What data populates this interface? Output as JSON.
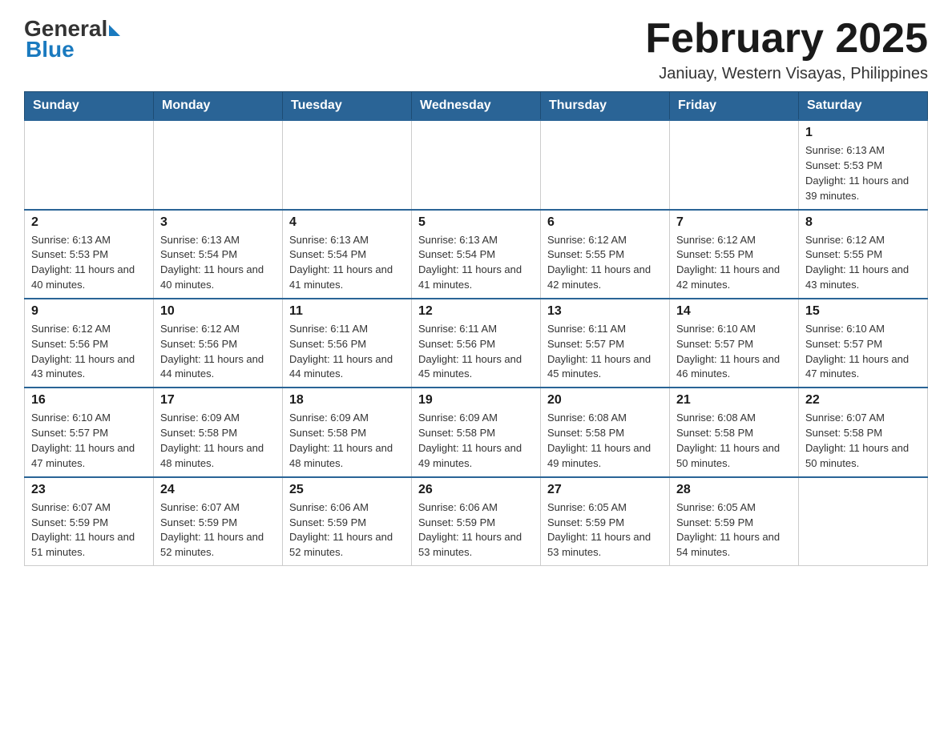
{
  "logo": {
    "general": "General",
    "blue": "Blue"
  },
  "title": "February 2025",
  "subtitle": "Janiuay, Western Visayas, Philippines",
  "days_of_week": [
    "Sunday",
    "Monday",
    "Tuesday",
    "Wednesday",
    "Thursday",
    "Friday",
    "Saturday"
  ],
  "weeks": [
    [
      {
        "day": "",
        "info": ""
      },
      {
        "day": "",
        "info": ""
      },
      {
        "day": "",
        "info": ""
      },
      {
        "day": "",
        "info": ""
      },
      {
        "day": "",
        "info": ""
      },
      {
        "day": "",
        "info": ""
      },
      {
        "day": "1",
        "info": "Sunrise: 6:13 AM\nSunset: 5:53 PM\nDaylight: 11 hours and 39 minutes."
      }
    ],
    [
      {
        "day": "2",
        "info": "Sunrise: 6:13 AM\nSunset: 5:53 PM\nDaylight: 11 hours and 40 minutes."
      },
      {
        "day": "3",
        "info": "Sunrise: 6:13 AM\nSunset: 5:54 PM\nDaylight: 11 hours and 40 minutes."
      },
      {
        "day": "4",
        "info": "Sunrise: 6:13 AM\nSunset: 5:54 PM\nDaylight: 11 hours and 41 minutes."
      },
      {
        "day": "5",
        "info": "Sunrise: 6:13 AM\nSunset: 5:54 PM\nDaylight: 11 hours and 41 minutes."
      },
      {
        "day": "6",
        "info": "Sunrise: 6:12 AM\nSunset: 5:55 PM\nDaylight: 11 hours and 42 minutes."
      },
      {
        "day": "7",
        "info": "Sunrise: 6:12 AM\nSunset: 5:55 PM\nDaylight: 11 hours and 42 minutes."
      },
      {
        "day": "8",
        "info": "Sunrise: 6:12 AM\nSunset: 5:55 PM\nDaylight: 11 hours and 43 minutes."
      }
    ],
    [
      {
        "day": "9",
        "info": "Sunrise: 6:12 AM\nSunset: 5:56 PM\nDaylight: 11 hours and 43 minutes."
      },
      {
        "day": "10",
        "info": "Sunrise: 6:12 AM\nSunset: 5:56 PM\nDaylight: 11 hours and 44 minutes."
      },
      {
        "day": "11",
        "info": "Sunrise: 6:11 AM\nSunset: 5:56 PM\nDaylight: 11 hours and 44 minutes."
      },
      {
        "day": "12",
        "info": "Sunrise: 6:11 AM\nSunset: 5:56 PM\nDaylight: 11 hours and 45 minutes."
      },
      {
        "day": "13",
        "info": "Sunrise: 6:11 AM\nSunset: 5:57 PM\nDaylight: 11 hours and 45 minutes."
      },
      {
        "day": "14",
        "info": "Sunrise: 6:10 AM\nSunset: 5:57 PM\nDaylight: 11 hours and 46 minutes."
      },
      {
        "day": "15",
        "info": "Sunrise: 6:10 AM\nSunset: 5:57 PM\nDaylight: 11 hours and 47 minutes."
      }
    ],
    [
      {
        "day": "16",
        "info": "Sunrise: 6:10 AM\nSunset: 5:57 PM\nDaylight: 11 hours and 47 minutes."
      },
      {
        "day": "17",
        "info": "Sunrise: 6:09 AM\nSunset: 5:58 PM\nDaylight: 11 hours and 48 minutes."
      },
      {
        "day": "18",
        "info": "Sunrise: 6:09 AM\nSunset: 5:58 PM\nDaylight: 11 hours and 48 minutes."
      },
      {
        "day": "19",
        "info": "Sunrise: 6:09 AM\nSunset: 5:58 PM\nDaylight: 11 hours and 49 minutes."
      },
      {
        "day": "20",
        "info": "Sunrise: 6:08 AM\nSunset: 5:58 PM\nDaylight: 11 hours and 49 minutes."
      },
      {
        "day": "21",
        "info": "Sunrise: 6:08 AM\nSunset: 5:58 PM\nDaylight: 11 hours and 50 minutes."
      },
      {
        "day": "22",
        "info": "Sunrise: 6:07 AM\nSunset: 5:58 PM\nDaylight: 11 hours and 50 minutes."
      }
    ],
    [
      {
        "day": "23",
        "info": "Sunrise: 6:07 AM\nSunset: 5:59 PM\nDaylight: 11 hours and 51 minutes."
      },
      {
        "day": "24",
        "info": "Sunrise: 6:07 AM\nSunset: 5:59 PM\nDaylight: 11 hours and 52 minutes."
      },
      {
        "day": "25",
        "info": "Sunrise: 6:06 AM\nSunset: 5:59 PM\nDaylight: 11 hours and 52 minutes."
      },
      {
        "day": "26",
        "info": "Sunrise: 6:06 AM\nSunset: 5:59 PM\nDaylight: 11 hours and 53 minutes."
      },
      {
        "day": "27",
        "info": "Sunrise: 6:05 AM\nSunset: 5:59 PM\nDaylight: 11 hours and 53 minutes."
      },
      {
        "day": "28",
        "info": "Sunrise: 6:05 AM\nSunset: 5:59 PM\nDaylight: 11 hours and 54 minutes."
      },
      {
        "day": "",
        "info": ""
      }
    ]
  ]
}
